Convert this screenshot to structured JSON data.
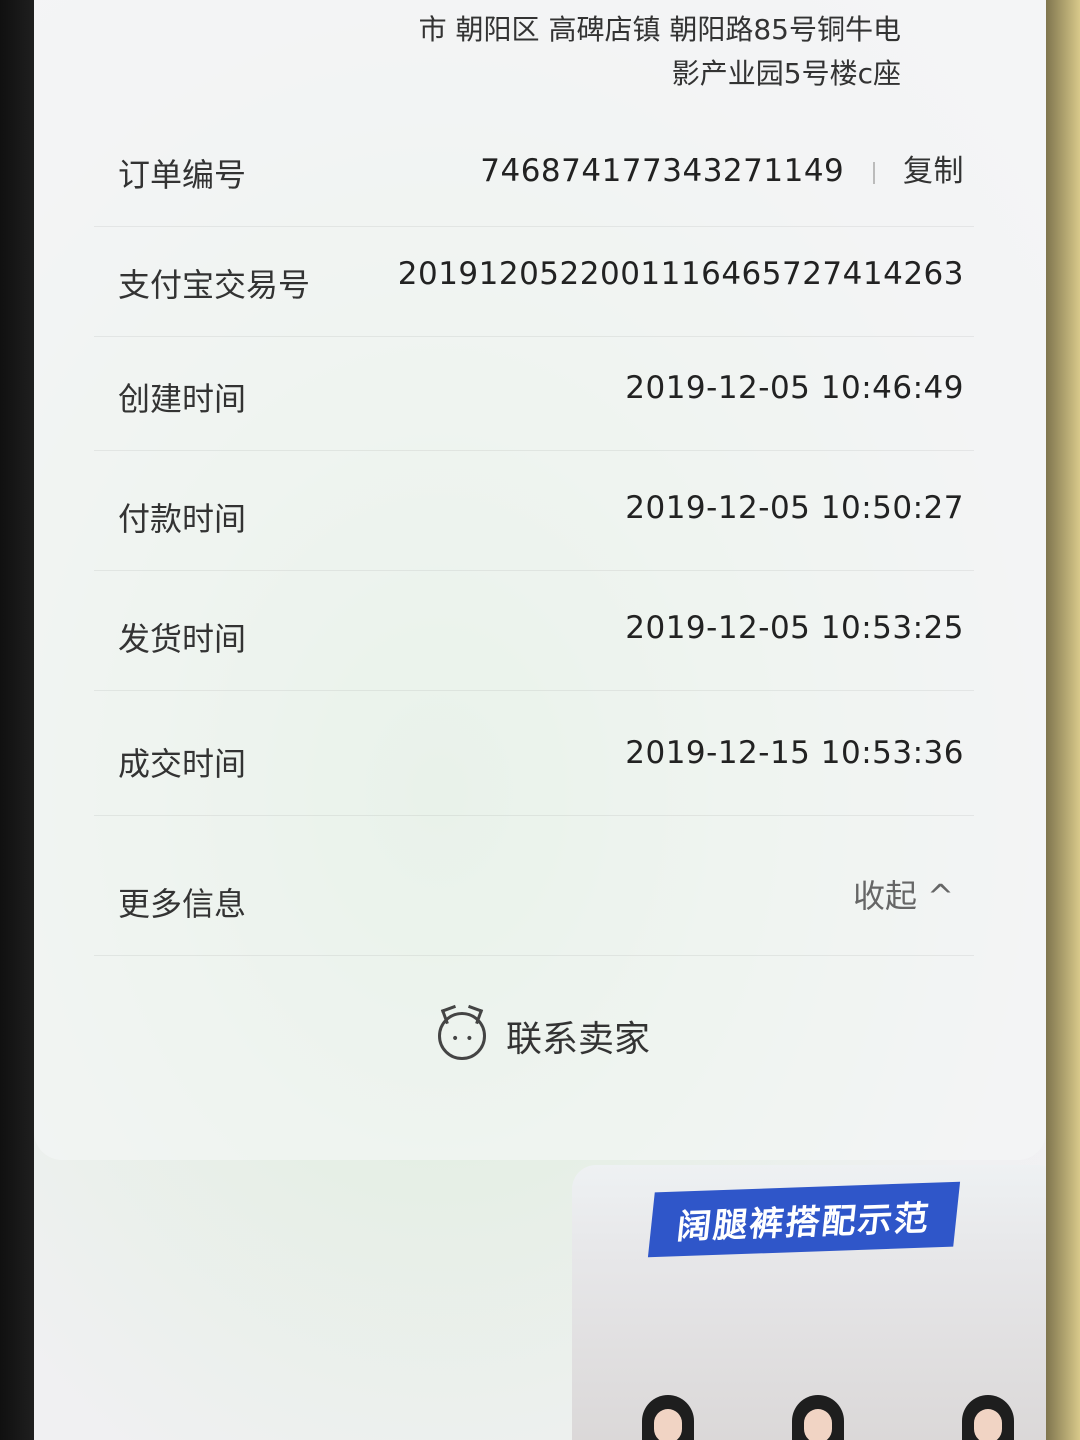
{
  "address": {
    "line1": "市 朝阳区 高碑店镇 朝阳路85号铜牛电",
    "line2": "影产业园5号楼c座"
  },
  "order_info": {
    "order_no": {
      "label": "订单编号",
      "value": "746874177343271149",
      "copy_label": "复制"
    },
    "alipay_no": {
      "label": "支付宝交易号",
      "value": "2019120522001116465727414263"
    },
    "created_time": {
      "label": "创建时间",
      "value": "2019-12-05 10:46:49"
    },
    "paid_time": {
      "label": "付款时间",
      "value": "2019-12-05 10:50:27"
    },
    "shipped_time": {
      "label": "发货时间",
      "value": "2019-12-05 10:53:25"
    },
    "completed_time": {
      "label": "成交时间",
      "value": "2019-12-15 10:53:36"
    },
    "more_info": {
      "label": "更多信息",
      "toggle_label": "收起 ^"
    }
  },
  "contact_seller": {
    "label": "联系卖家",
    "icon": "wangwang-chat-icon"
  },
  "promo": {
    "title": "阔腿裤搭配示范"
  }
}
